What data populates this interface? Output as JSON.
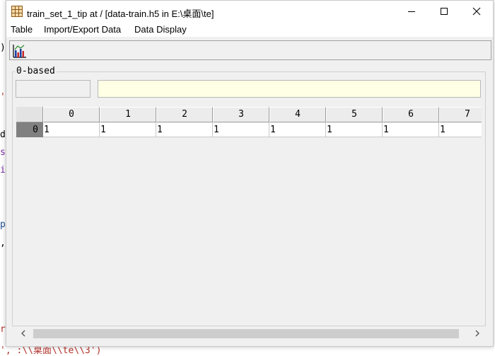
{
  "window": {
    "title": "train_set_1_tip  at  /  [data-train.h5  in  E:\\桌面\\te]",
    "app_icon": "table-grid-icon"
  },
  "controls": {
    "minimize": "minimize-icon",
    "maximize": "maximize-icon",
    "close": "close-icon"
  },
  "menu": [
    {
      "label": "Table"
    },
    {
      "label": "Import/Export Data"
    },
    {
      "label": "Data Display"
    }
  ],
  "toolbar": {
    "chart_button_icon": "bar-chart-icon"
  },
  "panel": {
    "label": "0-based",
    "index_value": "",
    "cell_value": ""
  },
  "table": {
    "columns": [
      "0",
      "1",
      "2",
      "3",
      "4",
      "5",
      "6",
      "7"
    ],
    "rows": [
      {
        "index": "0",
        "cells": [
          "1",
          "1",
          "1",
          "1",
          "1",
          "1",
          "1",
          "1"
        ]
      }
    ]
  },
  "background_editor": {
    "glyphs": [
      {
        "char": ")",
        "color": "#000000"
      },
      {
        "char": "'",
        "color": "#b4332b"
      },
      {
        "char": "d",
        "color": "#000000"
      },
      {
        "char": "s",
        "color": "#7a2ca6"
      },
      {
        "char": "i",
        "color": "#7a2ca6"
      },
      {
        "char": "p",
        "color": "#1f4f8f"
      },
      {
        "char": ",",
        "color": "#000000"
      },
      {
        "char": "r",
        "color": "#b4332b"
      }
    ],
    "bottom_line": "', :\\\\桌面\\\\te\\\\3')"
  },
  "colors": {
    "window_bg": "#f0f0f0",
    "value_field_bg": "#ffffe6",
    "selected_row_header": "#808080"
  }
}
